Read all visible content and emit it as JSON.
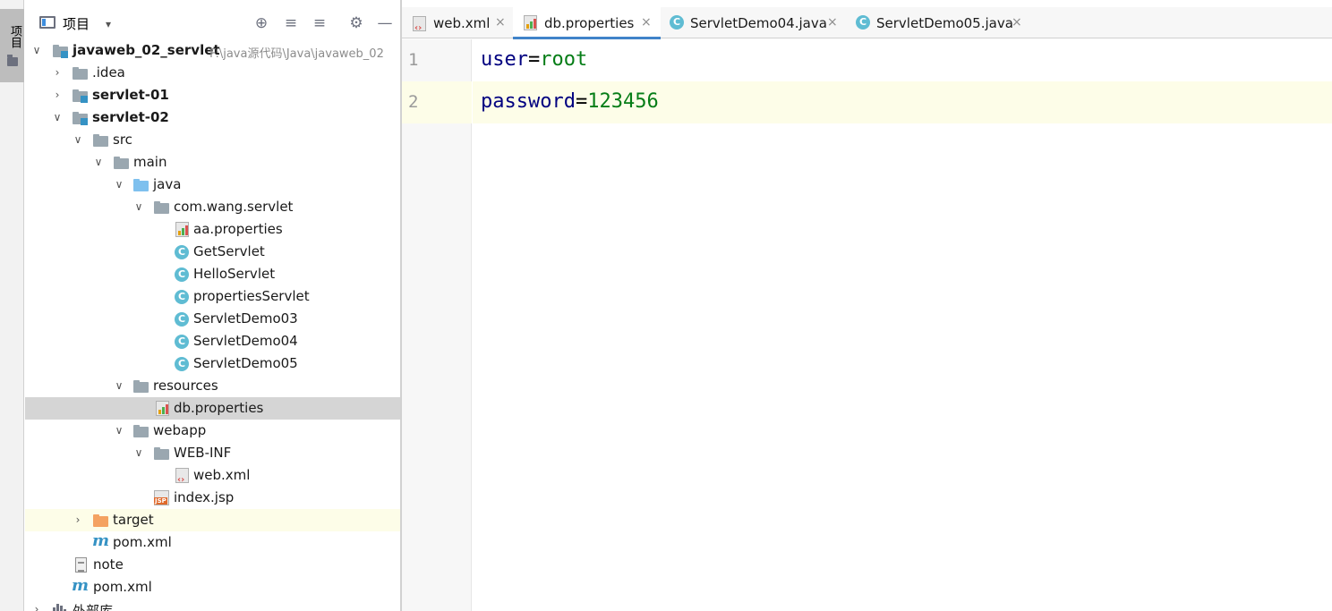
{
  "sidebar_strip": {
    "label": "项目"
  },
  "project_panel": {
    "title": "项目",
    "dropdown": "▾",
    "buttons": [
      "⊕",
      "≡",
      "≡",
      "⚙",
      "—"
    ]
  },
  "tree": [
    {
      "label": "javaweb_02_servlet",
      "path": "F:\\java源代码\\Java\\javaweb_02"
    },
    {
      "label": ".idea"
    },
    {
      "label": "servlet-01"
    },
    {
      "label": "servlet-02"
    },
    {
      "label": "src"
    },
    {
      "label": "main"
    },
    {
      "label": "java"
    },
    {
      "label": "com.wang.servlet"
    },
    {
      "label": "aa.properties"
    },
    {
      "label": "GetServlet"
    },
    {
      "label": "HelloServlet"
    },
    {
      "label": "propertiesServlet"
    },
    {
      "label": "ServletDemo03"
    },
    {
      "label": "ServletDemo04"
    },
    {
      "label": "ServletDemo05"
    },
    {
      "label": "resources"
    },
    {
      "label": "db.properties"
    },
    {
      "label": "webapp"
    },
    {
      "label": "WEB-INF"
    },
    {
      "label": "web.xml"
    },
    {
      "label": "index.jsp"
    },
    {
      "label": "target"
    },
    {
      "label": "pom.xml"
    },
    {
      "label": "note"
    },
    {
      "label": "pom.xml"
    },
    {
      "label": "外部库"
    }
  ],
  "class_icon_letter": "C",
  "tabs": [
    {
      "label": "web.xml",
      "close": "×"
    },
    {
      "label": "db.properties",
      "close": "×"
    },
    {
      "label": "ServletDemo04.java",
      "close": "×"
    },
    {
      "label": "ServletDemo05.java",
      "close": "×"
    }
  ],
  "editor": {
    "line_numbers": [
      "1",
      "2"
    ],
    "lines": [
      {
        "key": "user",
        "sep": "=",
        "value": "root"
      },
      {
        "key": "password",
        "sep": "=",
        "value": "123456"
      }
    ]
  },
  "colors": {
    "accent": "#4083c9",
    "selection": "#d5d5d5",
    "current_line": "#fdfde8",
    "key": "#000080",
    "value": "#067d17"
  }
}
